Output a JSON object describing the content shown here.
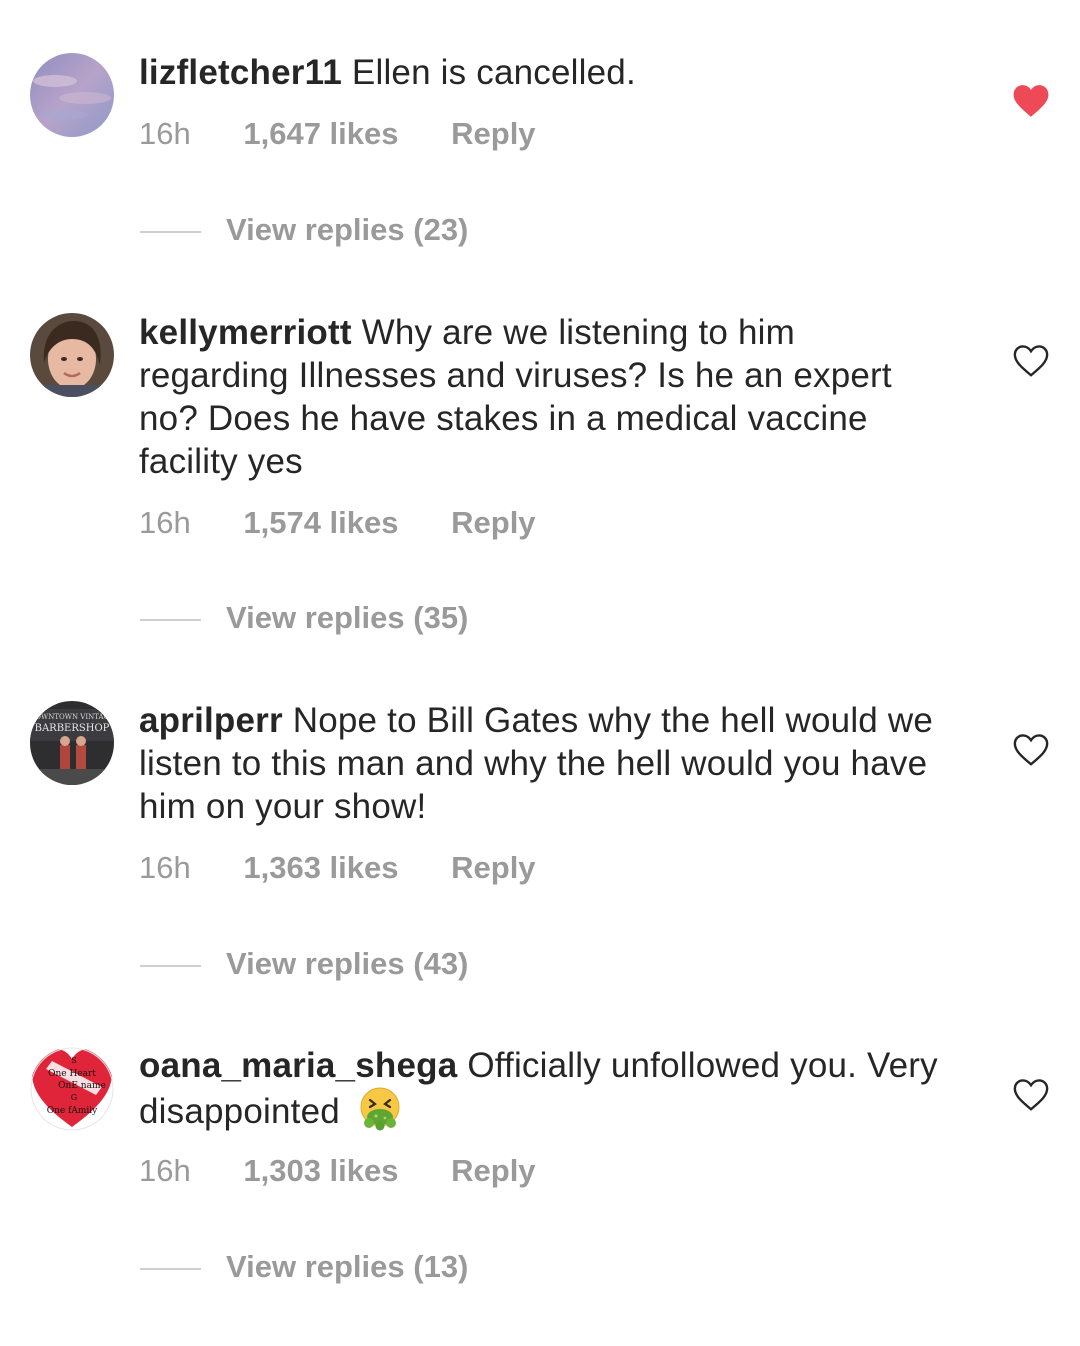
{
  "comments": [
    {
      "username": "lizfletcher11",
      "text": "Ellen is cancelled.",
      "time": "16h",
      "likes": "1,647 likes",
      "reply_label": "Reply",
      "view_replies": "View replies (23)",
      "liked": true,
      "heart_icon": "heart-filled-icon"
    },
    {
      "username": "kellymerriott",
      "text": "Why are we listening to him regarding Illnesses and viruses? Is he an expert no? Does he have stakes in a medical vaccine facility yes",
      "time": "16h",
      "likes": "1,574 likes",
      "reply_label": "Reply",
      "view_replies": "View replies (35)",
      "liked": false,
      "heart_icon": "heart-outline-icon"
    },
    {
      "username": "aprilperr",
      "text": "Nope to Bill Gates why the hell would we listen to this man and why the hell would you have him on your show!",
      "time": "16h",
      "likes": "1,363 likes",
      "reply_label": "Reply",
      "view_replies": "View replies (43)",
      "liked": false,
      "heart_icon": "heart-outline-icon",
      "avatar_text": [
        "DOWNTOWN VINTAGE",
        "BARBERSHOP"
      ]
    },
    {
      "username": "oana_maria_shega",
      "text": "Officially unfollowed you. Very disappointed",
      "emoji": "nauseated-face-icon",
      "time": "16h",
      "likes": "1,303 likes",
      "reply_label": "Reply",
      "view_replies": "View replies (13)",
      "liked": false,
      "heart_icon": "heart-outline-icon",
      "avatar_text": [
        "S",
        "One Heart",
        "OnE name",
        "G",
        "One fAmily"
      ]
    }
  ],
  "colors": {
    "text": "#262626",
    "secondary": "#9a9a9a",
    "like": "#ed4956"
  }
}
